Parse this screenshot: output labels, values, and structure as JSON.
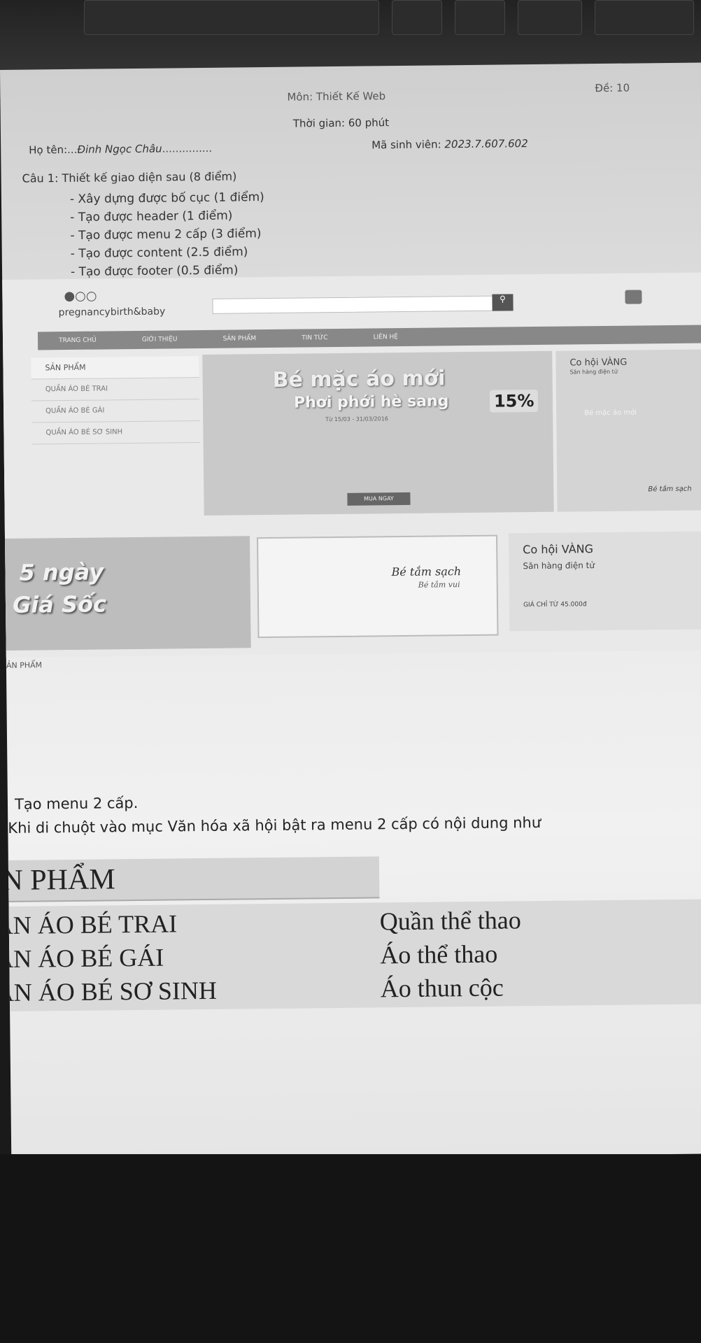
{
  "exam": {
    "subject": "Môn: Thiết Kế Web",
    "code": "Đề: 10",
    "time": "Thời gian: 60 phút",
    "name_label": "Họ tên:",
    "name_value": "Đinh Ngọc Châu",
    "sid_label": "Mã sinh viên:",
    "sid_value": "2023.7.607.602",
    "question": "Câu 1: Thiết kế giao diện sau (8 điểm)",
    "tasks": [
      "Xây dựng được bố cục (1 điểm)",
      "Tạo được header (1 điểm)",
      "Tạo được menu 2 cấp (3 điểm)",
      "Tạo được content (2.5 điểm)",
      "Tạo được footer (0.5 điểm)"
    ]
  },
  "site": {
    "logo": "pregnancybirth&baby",
    "nav": [
      "TRANG CHỦ",
      "GIỚI THIỆU",
      "SẢN PHẨM",
      "TIN TỨC",
      "LIÊN HỆ"
    ],
    "sidebar_title": "SẢN PHẨM",
    "sidebar_items": [
      "QUẦN ÁO BÉ TRAI",
      "QUẦN ÁO BÉ GÁI",
      "QUẦN ÁO BÉ SƠ SINH"
    ],
    "banner_title": "Bé mặc áo mới",
    "banner_sub": "Phơi phới hè sang",
    "banner_date": "Từ 15/03 - 31/03/2016",
    "banner_discount": "15%",
    "banner_button": "MUA NGAY",
    "right_title": "Co hội VÀNG",
    "right_sub": "Săn hàng điện tử",
    "right_banner2": "Bé mặc áo mới",
    "right_banner3": "Bé tắm sạch",
    "promo_a1": "5 ngày",
    "promo_a2": "Giá Sốc",
    "promo_b1": "Bé tắm sạch",
    "promo_b2": "Bé tắm vui",
    "promo_c1": "Co hội VÀNG",
    "promo_c2": "Săn hàng điện tử",
    "promo_c3": "GIÁ CHỈ TỪ 45.000đ",
    "products_label": "ẢN PHẨM"
  },
  "menu2": {
    "title": "Tạo menu 2 cấp.",
    "desc": "Khi di chuột vào mục Văn hóa xã hội bật ra menu 2 cấp có nội dung như",
    "head": "ẢN PHẨM",
    "left": [
      "ẦN ÁO BÉ TRAI",
      "ẦN ÁO BÉ GÁI",
      "ẦN ÁO BÉ SƠ SINH"
    ],
    "right": [
      "Quần thể thao",
      "Áo thể thao",
      "Áo thun cộc"
    ]
  }
}
